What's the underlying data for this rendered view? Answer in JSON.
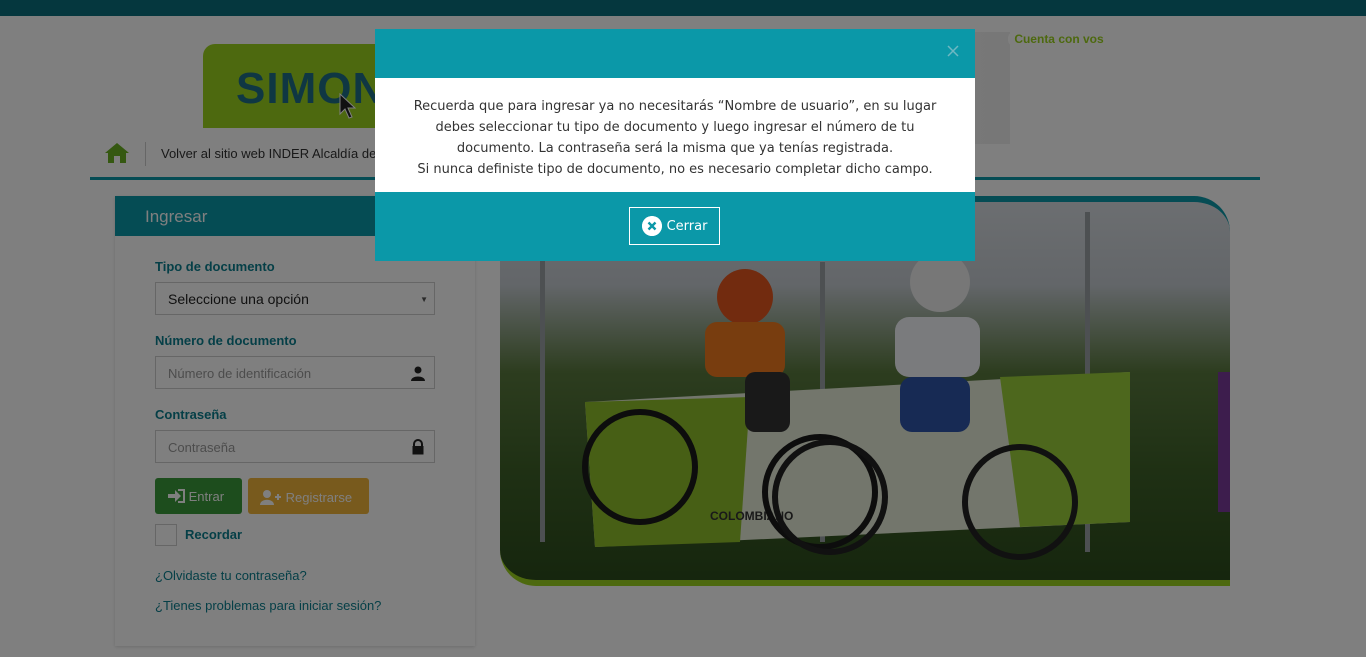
{
  "header": {
    "logo_text": "SIMON",
    "slogan": "Cuenta con vos"
  },
  "nav": {
    "back_link": "Volver al sitio web INDER Alcaldía de"
  },
  "login": {
    "title": "Ingresar",
    "doc_type_label": "Tipo de documento",
    "doc_type_value": "Seleccione una opción",
    "doc_number_label": "Número de documento",
    "doc_number_placeholder": "Número de identificación",
    "password_label": "Contraseña",
    "password_placeholder": "Contraseña",
    "enter_button": "Entrar",
    "register_button": "Registrarse",
    "remember_label": "Recordar",
    "forgot_link": "¿Olvidaste tu contraseña?",
    "problems_link": "¿Tienes problemas para iniciar sesión?"
  },
  "photo": {
    "banner_text": "COLOMBIANO"
  },
  "modal": {
    "line1": "Recuerda que para ingresar ya no necesitarás “Nombre de usuario”, en su lugar debes seleccionar tu tipo de documento y luego ingresar el número de tu documento. La contraseña será la misma que ya tenías registrada.",
    "line2": "Si nunca definiste tipo de documento, no es necesario completar dicho campo.",
    "close_button": "Cerrar"
  },
  "colors": {
    "teal": "#0b98a8",
    "green": "#9bd21e",
    "enter_green": "#3a9a3a",
    "register_orange": "#f0b43a"
  },
  "icons": [
    "home-icon",
    "user-icon",
    "lock-icon",
    "sign-in-icon",
    "user-plus-icon",
    "close-icon",
    "close-circle-icon",
    "chevron-down-icon",
    "cursor-icon"
  ]
}
